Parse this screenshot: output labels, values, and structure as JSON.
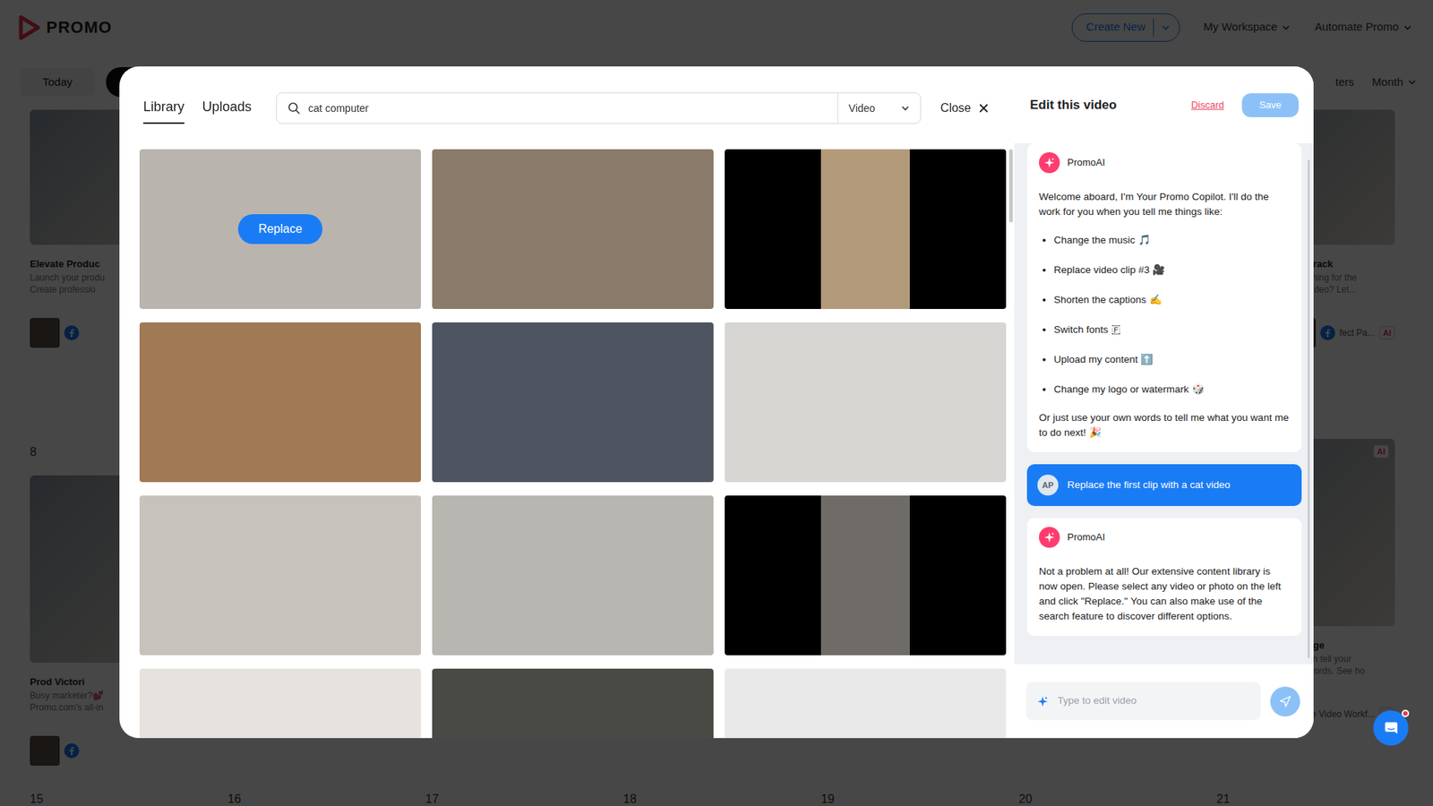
{
  "app": {
    "logo": "PROMO",
    "create_button": "Create New",
    "menus": [
      "My Workspace",
      "Automate Promo"
    ],
    "toolbar": {
      "today": "Today",
      "filters": "ters",
      "view": "Month"
    },
    "calendar": {
      "weeks": [
        {
          "days": [
            {
              "post": {
                "title": "Elevate Produc",
                "lines": [
                  "Launch your produ",
                  "Create professio"
                ]
              }
            },
            {},
            {},
            {},
            {},
            {},
            {
              "post": {
                "title": "Track",
                "lines": [
                  "ching for the",
                  "video? Let..."
                ],
                "footer": "fect Pa...",
                "badge": "AI"
              }
            }
          ]
        },
        {
          "days": [
            {
              "date": "8",
              "post": {
                "title": "Prod Victori",
                "lines": [
                  "Busy marketer?💕",
                  "Promo.com's all-in"
                ]
              }
            },
            {},
            {},
            {},
            {},
            {},
            {
              "post": {
                "title": "age",
                "lines": [
                  "an tell your",
                  "words. See ho"
                ],
                "footer": "Invisible Video Workf...",
                "badge": "AI",
                "image_badge": "AI"
              }
            }
          ]
        },
        {
          "days": [
            {
              "date": "15"
            },
            {
              "date": "16"
            },
            {
              "date": "17"
            },
            {
              "date": "18"
            },
            {
              "date": "19"
            },
            {
              "date": "20"
            },
            {
              "date": "21"
            }
          ]
        }
      ]
    }
  },
  "modal": {
    "tabs": [
      {
        "label": "Library",
        "selected": true
      },
      {
        "label": "Uploads",
        "selected": false
      }
    ],
    "search": {
      "value": "cat computer"
    },
    "media_type": "Video",
    "close": "Close",
    "hover_button": "Replace",
    "tiles": [
      {
        "kind": "landscape",
        "hovered": true,
        "color": "#b9b4ae"
      },
      {
        "kind": "landscape",
        "hovered": false,
        "color": "#8a7a6a"
      },
      {
        "kind": "portrait",
        "hovered": false,
        "color": "#b39a7a"
      },
      {
        "kind": "landscape",
        "hovered": false,
        "color": "#a07a55"
      },
      {
        "kind": "landscape",
        "hovered": false,
        "color": "#4f5560"
      },
      {
        "kind": "landscape",
        "hovered": false,
        "color": "#d8d6d3"
      },
      {
        "kind": "landscape",
        "hovered": false,
        "color": "#c7c3bc"
      },
      {
        "kind": "landscape",
        "hovered": false,
        "color": "#b8b6b0"
      },
      {
        "kind": "portrait",
        "hovered": false,
        "color": "#6f6c68"
      },
      {
        "kind": "landscape",
        "hovered": false,
        "color": "#e6e3df"
      },
      {
        "kind": "landscape",
        "hovered": false,
        "color": "#4a4a45"
      },
      {
        "kind": "landscape",
        "hovered": false,
        "color": "#e9e9e9"
      }
    ]
  },
  "editor": {
    "title": "Edit this video",
    "discard": "Discard",
    "save": {
      "label": "Save",
      "disabled": true
    },
    "messages": [
      {
        "kind": "bot",
        "author": "PromoAI",
        "text": "Welcome aboard, I'm Your Promo Copilot. I'll do the work for you when you tell me things like:",
        "bullets": [
          "Change the music 🎵",
          "Replace video clip #3 🎥",
          "Shorten the captions ✍️",
          "Switch fonts 🇫",
          "Upload my content ⬆️",
          "Change my logo or watermark 🎲"
        ],
        "closing": "Or just use your own words to tell me what you want me to do next! 🎉"
      },
      {
        "kind": "user",
        "avatar": "AP",
        "text": "Replace the first clip with a cat video"
      },
      {
        "kind": "bot",
        "author": "PromoAI",
        "text": "Not a problem at all! Our extensive content library is now open. Please select any video or photo on the left and click \"Replace.\" You can also make use of the search feature to discover different options."
      }
    ],
    "input": {
      "placeholder": "Type to edit video"
    },
    "send": {
      "disabled": true
    }
  }
}
